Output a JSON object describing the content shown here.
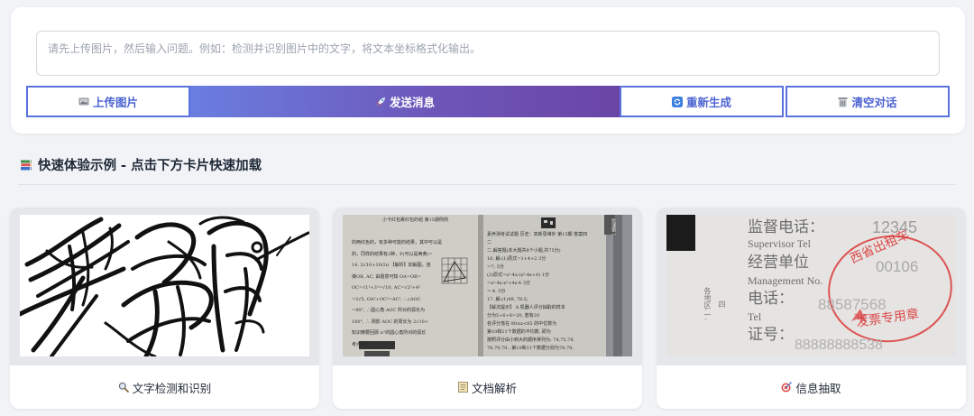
{
  "input": {
    "placeholder": "请先上传图片，然后输入问题。例如：检测并识别图片中的文字，将文本坐标格式化输出。"
  },
  "buttons": {
    "upload": "上传图片",
    "send": "发送消息",
    "regenerate": "重新生成",
    "clear": "清空对话"
  },
  "examples": {
    "title": "快速体验示例 - 点击下方卡片快速加载",
    "cards": [
      {
        "label": "文字检测和识别",
        "icon": "magnifier-icon"
      },
      {
        "label": "文档解析",
        "icon": "document-icon"
      },
      {
        "label": "信息抽取",
        "icon": "target-icon"
      }
    ]
  },
  "thumbnails": {
    "document": {
      "header": "小卡红包裹红包的组 第15期例例",
      "badge": "优课第一",
      "lines_left": [
        "的两红色的，有多种可能的结果，其中可以是",
        "的，同样的结果有2种，P(可以是两黄)=",
        "14. 2√10+10/2π 【解析】如解图，连",
        "接OB, AC, 由题意可知 OA=OB=",
        "OC=√1²+3²=√10, AC=√2²+4²",
        "=2√5, OA²+OC²=AC², ∴∠AOC",
        "=90°, ∴圆心角 AOC 所对的弧长为",
        "180°, ∴ 阴影 AOC 的周长为 2√10+",
        "知识精要回顾 n°的圆心角所对的弧长",
        "考点巩固"
      ],
      "lines_right": [
        "素养测考试试题 历史：高新思维外 第15期 答案四",
        "二",
        "二.解答题(本大题共8个小题,共75分)",
        "16. 解:(1)原式=1+4+2    3分",
        "=7;    5分",
        "(2)原式=x²-4x-(x²-4x+4)    1分",
        "=x²-4x-x²+4x-4    3分",
        "=-4.    5分",
        "17. 解:(1)49, 78.5;",
        "【解法提示】 A 机器人评分抽取的样本",
        "分为5+6+8=20, 若有20",
        "名评分落在 80≤x<85 的中位数为",
        "第10和11个数据的平均数, 即为",
        "按照评分由小到大的顺序排列为: 74,75,78,",
        "78,79,79…第10和11个数据分别为78,79,"
      ]
    },
    "invoice": {
      "lines": [
        "监督电话：",
        "Supervisor Tel",
        "经营单位",
        "Management No.",
        "电话：",
        "Tel",
        "证号："
      ],
      "numbers": [
        "12345",
        "00106",
        "88587568",
        "88888888538"
      ],
      "stamp_top": "西省出租车",
      "stamp_bottom": "发票专用章",
      "side_text": "各地区.一.",
      "side_text_2": "四"
    }
  },
  "colors": {
    "accent": "#5b73de",
    "gradient_start": "#6a7ee0",
    "gradient_end": "#6a45a6",
    "stamp_red": "#d93a3a"
  }
}
